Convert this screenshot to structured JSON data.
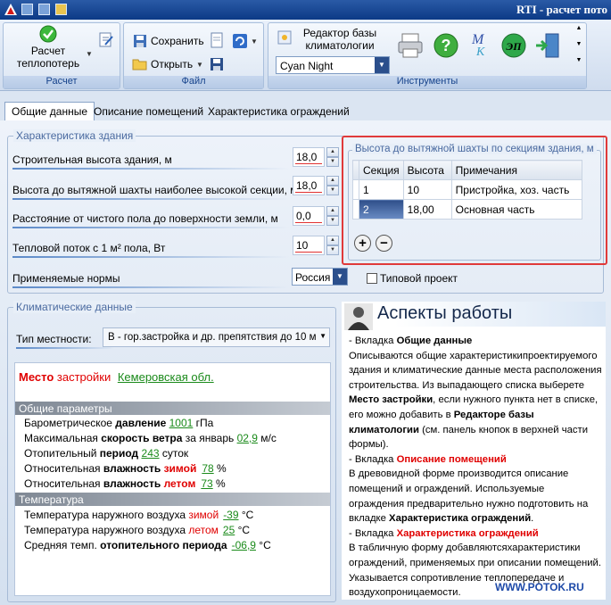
{
  "window": {
    "title": "RTI - расчет пото"
  },
  "ribbon": {
    "groups": {
      "calc": {
        "label": "Расчет",
        "button": "Расчет теплопотерь"
      },
      "file": {
        "label": "Файл",
        "save": "Сохранить",
        "open": "Открыть"
      },
      "tools": {
        "label": "Инструменты",
        "db_editor": "Редактор базы климатологии",
        "theme_value": "Cyan Night"
      }
    }
  },
  "tabs": [
    "Общие данные",
    "Описание помещений",
    "Характеристика ограждений"
  ],
  "building": {
    "legend": "Характеристика здания",
    "fields": [
      {
        "label": "Строительная высота здания, м",
        "value": "18,0"
      },
      {
        "label": "Высота  до вытяжной шахты наиболее высокой секции, м",
        "value": "18,0"
      },
      {
        "label": "Расстояние от чистого пола  до поверхности земли, м",
        "value": "0,0"
      },
      {
        "label": "Тепловой поток с 1 м² пола, Вт",
        "value": "10"
      }
    ],
    "norms_label": "Применяемые нормы",
    "norms_value": "Россия",
    "typical_label": "Типовой проект"
  },
  "shaft": {
    "legend": "Высота до вытяжной шахты по секциям здания, м",
    "columns": [
      "Секция",
      "Высота",
      "Примечания"
    ],
    "rows": [
      {
        "section": "1",
        "height": "10",
        "note": "Пристройка, хоз. часть"
      },
      {
        "section": "2",
        "height": "18,00",
        "note": "Основная часть"
      }
    ],
    "add": "+",
    "remove": "−"
  },
  "climate": {
    "legend": "Климатические данные",
    "terrain_label": "Тип местности:",
    "terrain_value": "В - гор.застройка и др. препятствия  до 10 м",
    "place_w1": "Место",
    "place_w2": "застройки",
    "place_value": "Кемеровская обл.",
    "general_header": "Общие параметры",
    "general": [
      {
        "a": "Барометрическое ",
        "b": "давление",
        "c": "  ",
        "v": "1001",
        "u": " гПа"
      },
      {
        "a": "Максимальная ",
        "b": "скорость ветра",
        "c": "  за январь ",
        "v": "02,9",
        "u": " м/с"
      },
      {
        "a": "Отопительный ",
        "b": "период",
        "c": "  ",
        "v": "243",
        "u": " суток"
      },
      {
        "a": "Относительная ",
        "b": "влажность",
        "c": " зимой",
        "v": "78",
        "u": " %"
      },
      {
        "a": "Относительная ",
        "b": "влажность",
        "c": " летом",
        "v": "73",
        "u": " %"
      }
    ],
    "temp_header": "Температура",
    "temp": [
      {
        "a": "Температура наружного воздуха ",
        "c": "зимой",
        "v": "-39",
        "u": " °С"
      },
      {
        "a": "Температура наружного воздуха ",
        "c": "летом",
        "v": "25",
        "u": " °С"
      },
      {
        "a": "Средняя темп. ",
        "b": "отопительного периода",
        "v": "-06,9",
        "u": " °С"
      }
    ]
  },
  "aspects": {
    "title": "Аспекты работы",
    "p1_lead": " - Вкладка ",
    "p1_bold": "Общие  данные",
    "p1_text": "Описываются общие  характеристикипроектируемого здания и климатические данные места расположения строительства. Из  выпадающего списка выберете ",
    "p1_b2": "Место застройки",
    "p1_text2": ", если нужного пункта нет в списке, его можно  добавить в ",
    "p1_b3": "Редакторе базы климатологии",
    "p1_text3": " (см. панель  кнопок в верхней части формы).",
    "p2_lead": "  - Вкладка ",
    "p2_hl": "Описание   помещений",
    "p2_text": "В древовидной форме производится описание помещений и ограждений. Используемые ограждения предварительно нужно подготовить на вкладке ",
    "p2_b": "Характеристика ограждений",
    "p2_end": ".",
    "p3_lead": " -  Вкладка ",
    "p3_hl": "Характеристика ограждений",
    "p3_text": "В  табличную форму  добавляютсяхарактеристики ограждений, применяемых при описании помещений. Указывается сопротивление  теплопередаче и воздухопроницаемости.",
    "footer": "WWW.POTOK.RU"
  },
  "colors": {
    "accent": "#e03a3a",
    "link_green": "#1a8a1a",
    "brand_blue": "#0c3a86"
  }
}
